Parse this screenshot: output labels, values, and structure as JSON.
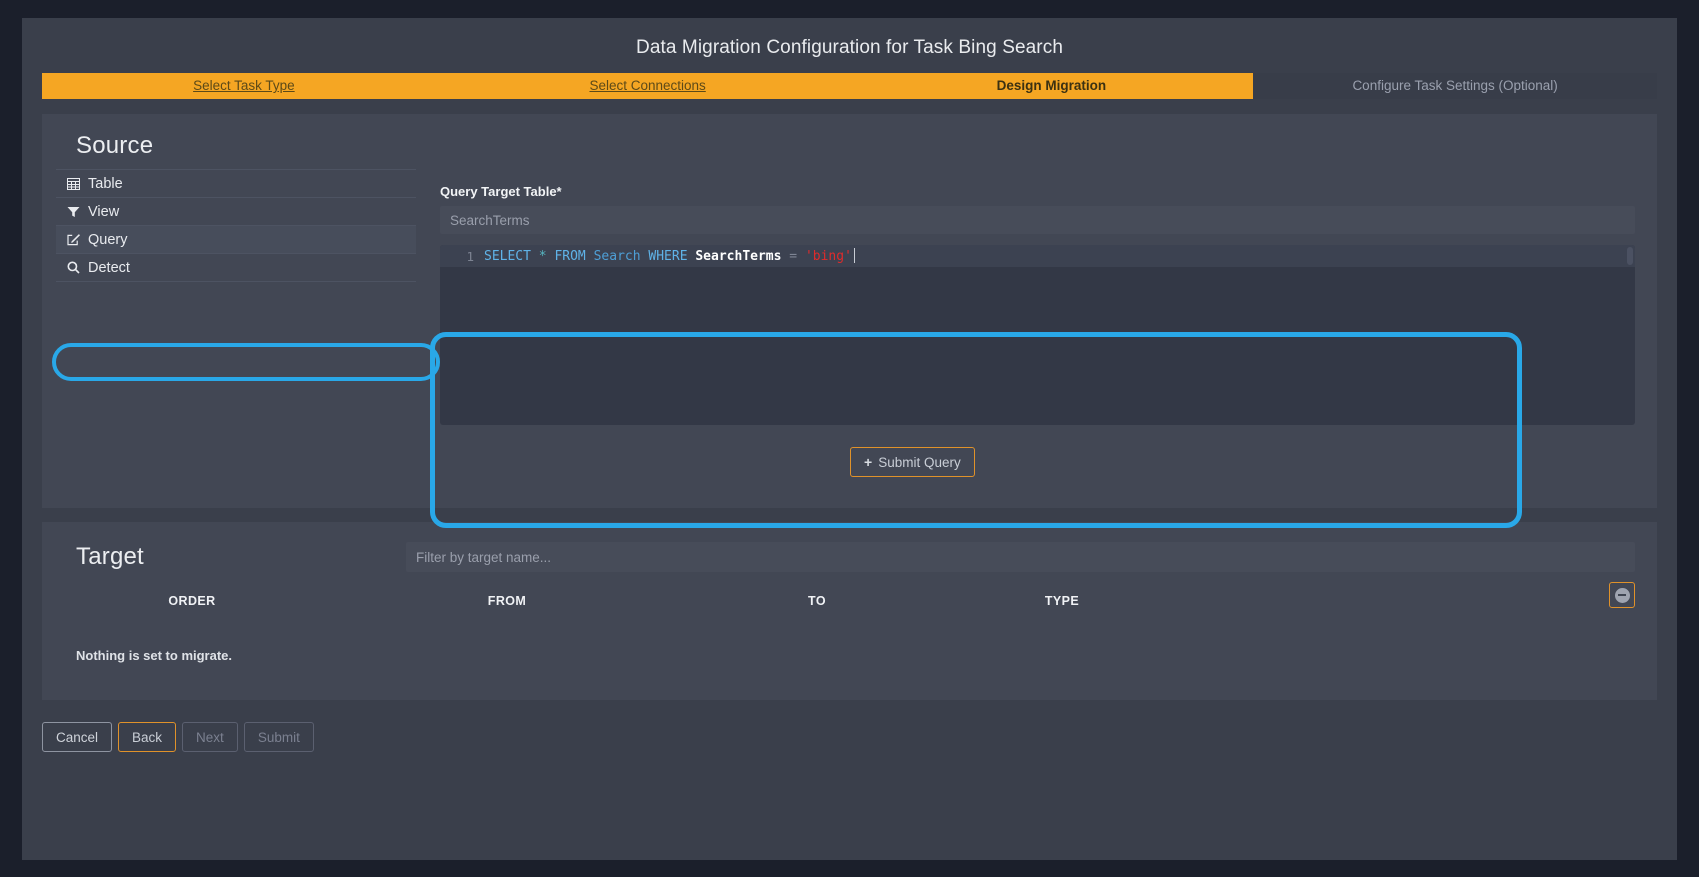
{
  "header": {
    "title": "Data Migration Configuration for Task Bing Search"
  },
  "wizard": {
    "steps": [
      {
        "label": "Select Task Type",
        "state": "done"
      },
      {
        "label": "Select Connections",
        "state": "done"
      },
      {
        "label": "Design Migration",
        "state": "current"
      },
      {
        "label": "Configure Task Settings (Optional)",
        "state": "inactive"
      }
    ]
  },
  "source": {
    "heading": "Source",
    "items": [
      {
        "label": "Table",
        "icon": "table-icon"
      },
      {
        "label": "View",
        "icon": "filter-icon"
      },
      {
        "label": "Query",
        "icon": "pencil-square-icon"
      },
      {
        "label": "Detect",
        "icon": "search-icon"
      }
    ],
    "selected_index": 2,
    "query_target_table": {
      "label": "Query Target Table*",
      "value": "SearchTerms",
      "placeholder": "SearchTerms"
    },
    "editor": {
      "line_number": "1",
      "tokens": [
        {
          "text": "SELECT",
          "type": "keyword"
        },
        {
          "text": " ",
          "type": "plain"
        },
        {
          "text": "*",
          "type": "operator"
        },
        {
          "text": " ",
          "type": "plain"
        },
        {
          "text": "FROM",
          "type": "keyword"
        },
        {
          "text": " ",
          "type": "plain"
        },
        {
          "text": "Search",
          "type": "table"
        },
        {
          "text": " ",
          "type": "plain"
        },
        {
          "text": "WHERE",
          "type": "keyword"
        },
        {
          "text": " ",
          "type": "plain"
        },
        {
          "text": "SearchTerms",
          "type": "column"
        },
        {
          "text": " ",
          "type": "plain"
        },
        {
          "text": "=",
          "type": "equals"
        },
        {
          "text": " ",
          "type": "plain"
        },
        {
          "text": "'bing'",
          "type": "string"
        }
      ],
      "full_text": "SELECT * FROM Search WHERE SearchTerms = 'bing'"
    },
    "submit_query_button": {
      "label": "Submit Query",
      "icon": "plus-icon"
    }
  },
  "target": {
    "heading": "Target",
    "filter": {
      "value": "",
      "placeholder": "Filter by target name..."
    },
    "columns": [
      "ORDER",
      "FROM",
      "TO",
      "TYPE"
    ],
    "remove_button_icon": "minus-circle-icon",
    "empty_message": "Nothing is set to migrate."
  },
  "footer": {
    "buttons": [
      {
        "label": "Cancel",
        "style": "normal",
        "enabled": true
      },
      {
        "label": "Back",
        "style": "orange",
        "enabled": true
      },
      {
        "label": "Next",
        "style": "disabled",
        "enabled": false
      },
      {
        "label": "Submit",
        "style": "disabled",
        "enabled": false
      }
    ]
  },
  "annotations": {
    "highlight_color": "#29a8e8",
    "accent_color": "#f5a623"
  }
}
